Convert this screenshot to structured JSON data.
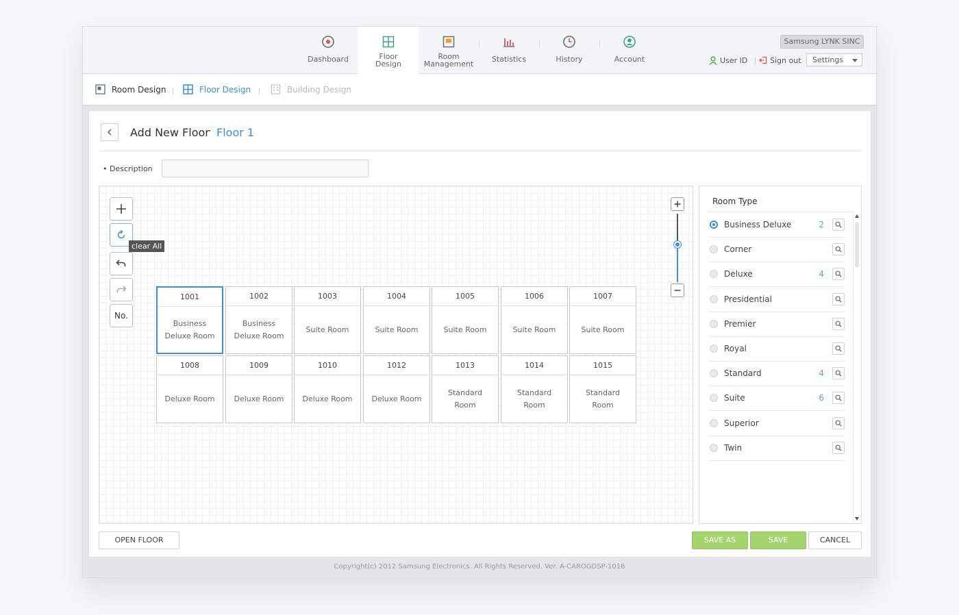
{
  "app": {
    "brand": "Samsung LYNK SINC"
  },
  "nav": {
    "items": [
      {
        "label": "Dashboard"
      },
      {
        "label_line1": "Floor",
        "label_line2": "Design"
      },
      {
        "label_line1": "Room",
        "label_line2": "Management"
      },
      {
        "label": "Statistics"
      },
      {
        "label": "History"
      },
      {
        "label": "Account"
      }
    ],
    "active": "Floor Design"
  },
  "header": {
    "user_id": "User ID",
    "sign_out": "Sign out",
    "settings": "Settings"
  },
  "subnav": {
    "items": [
      {
        "label": "Room Design"
      },
      {
        "label": "Floor Design"
      },
      {
        "label": "Building Design"
      }
    ]
  },
  "page": {
    "title": "Add New Floor",
    "separator": "·",
    "floor_name": "Floor 1",
    "description_label": "Description",
    "description_value": ""
  },
  "toolbar": {
    "number_label": "No.",
    "tooltip": "clear All"
  },
  "rooms": [
    {
      "num": "1001",
      "type": "Business Deluxe Room",
      "selected": true
    },
    {
      "num": "1002",
      "type": "Business Deluxe Room"
    },
    {
      "num": "1003",
      "type": "Suite Room"
    },
    {
      "num": "1004",
      "type": "Suite Room"
    },
    {
      "num": "1005",
      "type": "Suite Room"
    },
    {
      "num": "1006",
      "type": "Suite Room"
    },
    {
      "num": "1007",
      "type": "Suite Room"
    },
    {
      "num": "1008",
      "type": "Deluxe Room"
    },
    {
      "num": "1009",
      "type": "Deluxe Room"
    },
    {
      "num": "1010",
      "type": "Deluxe Room"
    },
    {
      "num": "1012",
      "type": "Deluxe Room"
    },
    {
      "num": "1013",
      "type": "Standard Room"
    },
    {
      "num": "1014",
      "type": "Standard Room"
    },
    {
      "num": "1015",
      "type": "Standard Room"
    }
  ],
  "room_types": {
    "title": "Room Type",
    "items": [
      {
        "name": "Business Deluxe",
        "count": "2",
        "selected": true
      },
      {
        "name": "Corner",
        "count": ""
      },
      {
        "name": "Deluxe",
        "count": "4"
      },
      {
        "name": "Presidential",
        "count": ""
      },
      {
        "name": "Premier",
        "count": ""
      },
      {
        "name": "Royal",
        "count": ""
      },
      {
        "name": "Standard",
        "count": "4"
      },
      {
        "name": "Suite",
        "count": "6"
      },
      {
        "name": "Superior",
        "count": ""
      },
      {
        "name": "Twin",
        "count": ""
      }
    ]
  },
  "buttons": {
    "open_floor": "OPEN FLOOR",
    "save_as": "SAVE AS",
    "save": "SAVE",
    "cancel": "CANCEL"
  },
  "footer": {
    "copyright": "Copyright(c) 2012 Samsung Electronics. All Rights Reserved. Ver. A-CAROGDSP-1016"
  },
  "colors": {
    "accent": "#3b8fdc",
    "save_green": "#a3d46d",
    "dashboard_icon": "#e0524a",
    "room_icon": "#f29a2e",
    "stats_icon": "#e05a7a",
    "account_icon": "#3aa58a"
  }
}
